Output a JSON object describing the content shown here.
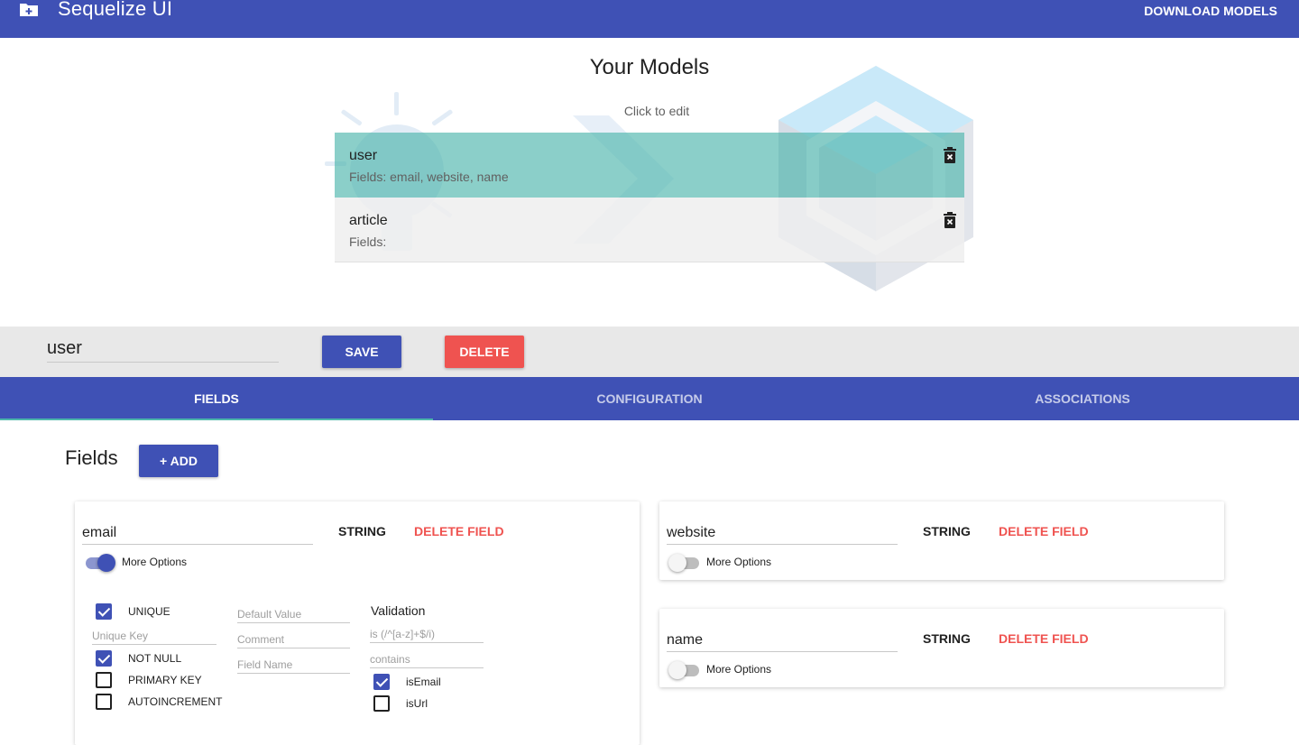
{
  "appbar": {
    "title": "Sequelize UI",
    "download_label": "DOWNLOAD MODELS"
  },
  "models": {
    "heading": "Your Models",
    "subheading": "Click to edit",
    "items": [
      {
        "name": "user",
        "fields": "Fields: email, website, name",
        "active": true
      },
      {
        "name": "article",
        "fields": "Fields:",
        "active": false
      }
    ]
  },
  "editor": {
    "model_name": "user",
    "save_label": "SAVE",
    "delete_label": "DELETE"
  },
  "tabs": [
    {
      "label": "FIELDS",
      "active": true
    },
    {
      "label": "CONFIGURATION",
      "active": false
    },
    {
      "label": "ASSOCIATIONS",
      "active": false
    }
  ],
  "fields_section": {
    "title": "Fields",
    "add_label": "+ ADD"
  },
  "fields": [
    {
      "name": "email",
      "type": "STRING",
      "delete_label": "DELETE FIELD",
      "more_options_label": "More Options",
      "more_options_on": true,
      "options": {
        "unique_label": "UNIQUE",
        "unique_checked": true,
        "unique_key_placeholder": "Unique Key",
        "not_null_label": "NOT NULL",
        "not_null_checked": true,
        "primary_key_label": "PRIMARY KEY",
        "primary_key_checked": false,
        "autoincrement_label": "AUTOINCREMENT",
        "autoincrement_checked": false,
        "default_value_placeholder": "Default Value",
        "comment_placeholder": "Comment",
        "field_name_placeholder": "Field Name",
        "validation_title": "Validation",
        "is_placeholder": "is (/^[a-z]+$/i)",
        "contains_placeholder": "contains",
        "is_email_label": "isEmail",
        "is_email_checked": true,
        "is_url_label": "isUrl",
        "is_url_checked": false
      }
    },
    {
      "name": "website",
      "type": "STRING",
      "delete_label": "DELETE FIELD",
      "more_options_label": "More Options",
      "more_options_on": false
    },
    {
      "name": "name",
      "type": "STRING",
      "delete_label": "DELETE FIELD",
      "more_options_label": "More Options",
      "more_options_on": false
    }
  ],
  "colors": {
    "primary": "#3f51b5",
    "accent": "#4db6ac",
    "danger": "#ef5350"
  },
  "icons": {
    "appbar": "folder-plus-icon",
    "model_delete": "trash-icon"
  }
}
